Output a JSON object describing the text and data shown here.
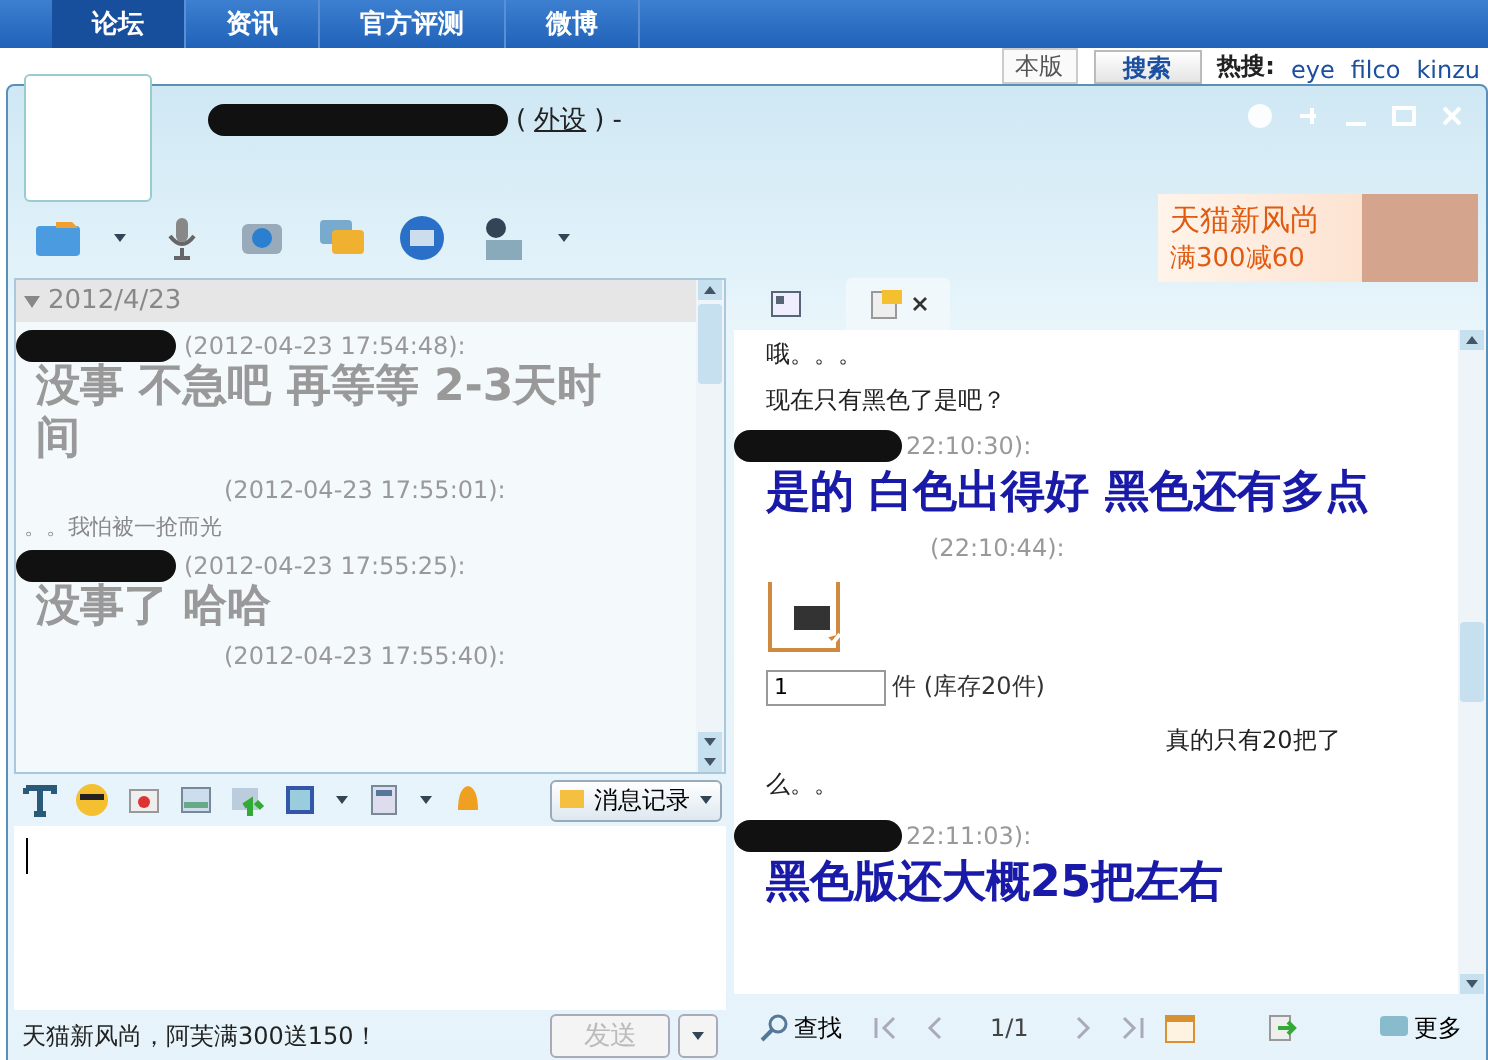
{
  "site_nav": {
    "tabs": [
      {
        "label": "论坛",
        "selected": true
      },
      {
        "label": "资讯",
        "selected": false
      },
      {
        "label": "官方评测",
        "selected": false
      },
      {
        "label": "微博",
        "selected": false
      }
    ],
    "search": {
      "scope": "本版",
      "button": "搜索"
    },
    "hot": {
      "label": "热搜:",
      "items": [
        "eye",
        "filco",
        "kinzu"
      ]
    }
  },
  "window": {
    "title_open": "(",
    "title_link": "外设",
    "title_close": ") -"
  },
  "ad_banner": {
    "line1": "天猫新风尚",
    "line2": "满300减60"
  },
  "history": {
    "date": "2012/4/23",
    "expanded": true,
    "messages": [
      {
        "name_scribbled": true,
        "time": "(2012-04-23 17:54:48):",
        "kind": "large",
        "text": "没事 不急吧 再等等 **2-3**天时间"
      },
      {
        "name_scribbled": false,
        "time": "(2012-04-23 17:55:01):",
        "kind": "small",
        "text": "。。我怕被一抢而光"
      },
      {
        "name_scribbled": true,
        "time": "(2012-04-23 17:55:25):",
        "kind": "large",
        "text": "没事了 哈哈"
      },
      {
        "name_scribbled": false,
        "time": "(2012-04-23 17:55:40):",
        "kind": "header_only"
      }
    ]
  },
  "history_button": {
    "label": "消息记录"
  },
  "input_bar": {
    "ad_text": "天猫新风尚，阿芙满300送150！",
    "send": {
      "label": "发送",
      "disabled": true
    }
  },
  "chat_tabs": [
    {
      "selected": false,
      "closable": false
    },
    {
      "selected": true,
      "closable": true
    }
  ],
  "chat": [
    {
      "kind": "text",
      "text": "哦。。。"
    },
    {
      "kind": "text",
      "text": "现在只有黑色了是吧？"
    },
    {
      "kind": "header",
      "name_scribbled": true,
      "time": "22:10:30):"
    },
    {
      "kind": "large",
      "text": "是的 白色出得好 黑色还有多点"
    },
    {
      "kind": "header",
      "name_scribbled": false,
      "time": "(22:10:44):"
    },
    {
      "kind": "product",
      "quantity": "1",
      "stock": "件 (库存20件)"
    },
    {
      "kind": "indented",
      "text": "真的只有20把了么。。"
    },
    {
      "kind": "header",
      "name_scribbled": true,
      "time": "22:11:03):"
    },
    {
      "kind": "large",
      "text": "黑色版还大概**25**把左右"
    }
  ],
  "chat_footer": {
    "find": "查找",
    "page": "1/1",
    "more": "更多"
  }
}
